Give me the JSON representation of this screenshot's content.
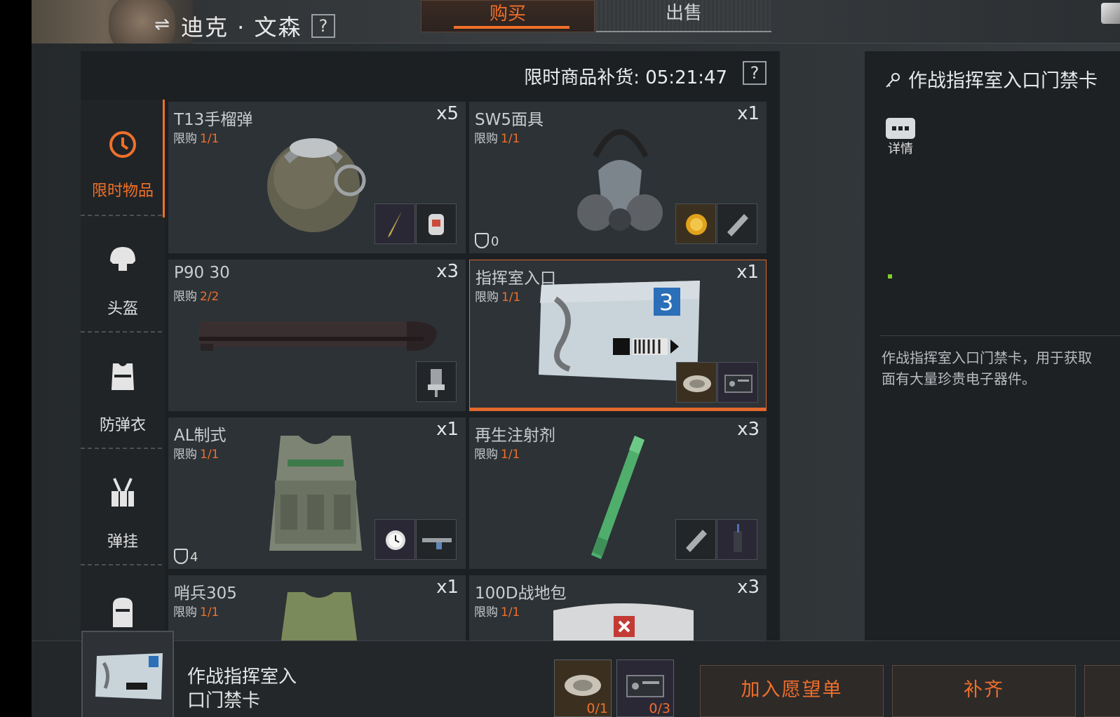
{
  "header": {
    "vendor_name": "迪克 · 文森",
    "help": "?",
    "tabs": [
      {
        "label": "购买",
        "active": true
      },
      {
        "label": "出售",
        "active": false
      }
    ]
  },
  "restock": {
    "label": "限时商品补货: 05:21:47",
    "help": "?"
  },
  "sidebar": {
    "items": [
      {
        "label": "限时物品",
        "icon": "clock-icon",
        "active": true
      },
      {
        "label": "头盔",
        "icon": "helmet-icon",
        "active": false
      },
      {
        "label": "防弹衣",
        "icon": "body-armor-icon",
        "active": false
      },
      {
        "label": "弹挂",
        "icon": "chest-rig-icon",
        "active": false
      },
      {
        "label": "",
        "icon": "backpack-icon",
        "active": false
      }
    ]
  },
  "limit_prefix": "限购",
  "items": [
    {
      "name": "T13手榴弹",
      "limit": "1/1",
      "qty": "x5",
      "armor": "",
      "materials": [
        "knife-icon",
        "bottle-icon"
      ]
    },
    {
      "name": "SW5面具",
      "limit": "1/1",
      "qty": "x1",
      "armor": "0",
      "materials": [
        "gold-coin-icon",
        "blade-icon"
      ]
    },
    {
      "name": "P90 30",
      "limit": "2/2",
      "qty": "x3",
      "armor": "",
      "materials": [
        "chair-icon"
      ]
    },
    {
      "name": "指挥室入口",
      "limit": "1/1",
      "qty": "x1",
      "armor": "",
      "materials": [
        "silver-plate-icon",
        "radio-icon"
      ],
      "selected": true
    },
    {
      "name": "AL制式",
      "limit": "1/1",
      "qty": "x1",
      "armor": "4",
      "materials": [
        "watch-icon",
        "gun-part-icon"
      ]
    },
    {
      "name": "再生注射剂",
      "limit": "1/1",
      "qty": "x3",
      "armor": "",
      "materials": [
        "blade-icon",
        "walkie-talkie-icon"
      ]
    },
    {
      "name": "哨兵305",
      "limit": "1/1",
      "qty": "x1",
      "armor": "",
      "materials": []
    },
    {
      "name": "100D战地包",
      "limit": "1/1",
      "qty": "x3",
      "armor": "",
      "materials": []
    }
  ],
  "detail": {
    "title": "作战指挥室入口门禁卡",
    "details_label": "详情",
    "description": "作战指挥室入口门禁卡，用于获取\n面有大量珍贵电子器件。"
  },
  "bottom": {
    "selected_name_line1": "作战指挥室入",
    "selected_name_line2": "口门禁卡",
    "materials": [
      {
        "icon": "silver-plate-icon",
        "count": "0/1"
      },
      {
        "icon": "radio-icon",
        "count": "0/3"
      }
    ],
    "wishlist_label": "加入愿望单",
    "fill_label": "补齐"
  },
  "colors": {
    "accent": "#f0702a",
    "panel": "#2c3236",
    "background": "#1c2023"
  }
}
